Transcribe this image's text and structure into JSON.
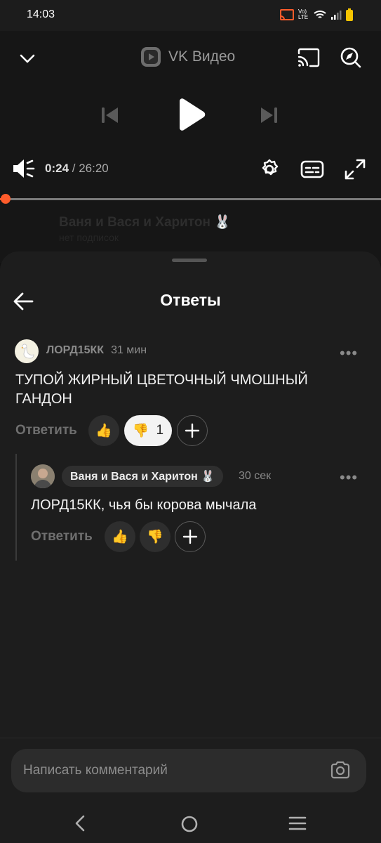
{
  "status_bar": {
    "time": "14:03",
    "volte_label": "Vo) LTE"
  },
  "player": {
    "app_title": "VK Видео",
    "current_time": "0:24",
    "separator": " / ",
    "duration": "26:20",
    "progress_fraction": 0.015,
    "ghost_channel": "Ваня и Вася и Харитон 🐰",
    "ghost_subtitle": "нет подписок"
  },
  "sheet": {
    "title": "Ответы"
  },
  "comments": [
    {
      "author": "ЛОРД15КК",
      "time": "31 мин",
      "text": "ТУПОЙ ЖИРНЫЙ  ЦВЕТОЧНЫЙ ЧМОШНЫЙ ГАНДОН",
      "reply_label": "Ответить",
      "like_emoji": "👍",
      "dislike_emoji": "👎",
      "dislike_count": "1",
      "more": "•••"
    },
    {
      "author": "Ваня и Вася и Харитон 🐰",
      "time": "30 сек",
      "text": "ЛОРД15КК, чья бы корова мычала",
      "reply_label": "Ответить",
      "like_emoji": "👍",
      "dislike_emoji": "👎",
      "more": "•••"
    }
  ],
  "composer": {
    "placeholder": "Написать комментарий"
  },
  "colors": {
    "accent": "#ff5c2b",
    "background": "#121212",
    "sheet": "#1d1d1d"
  }
}
